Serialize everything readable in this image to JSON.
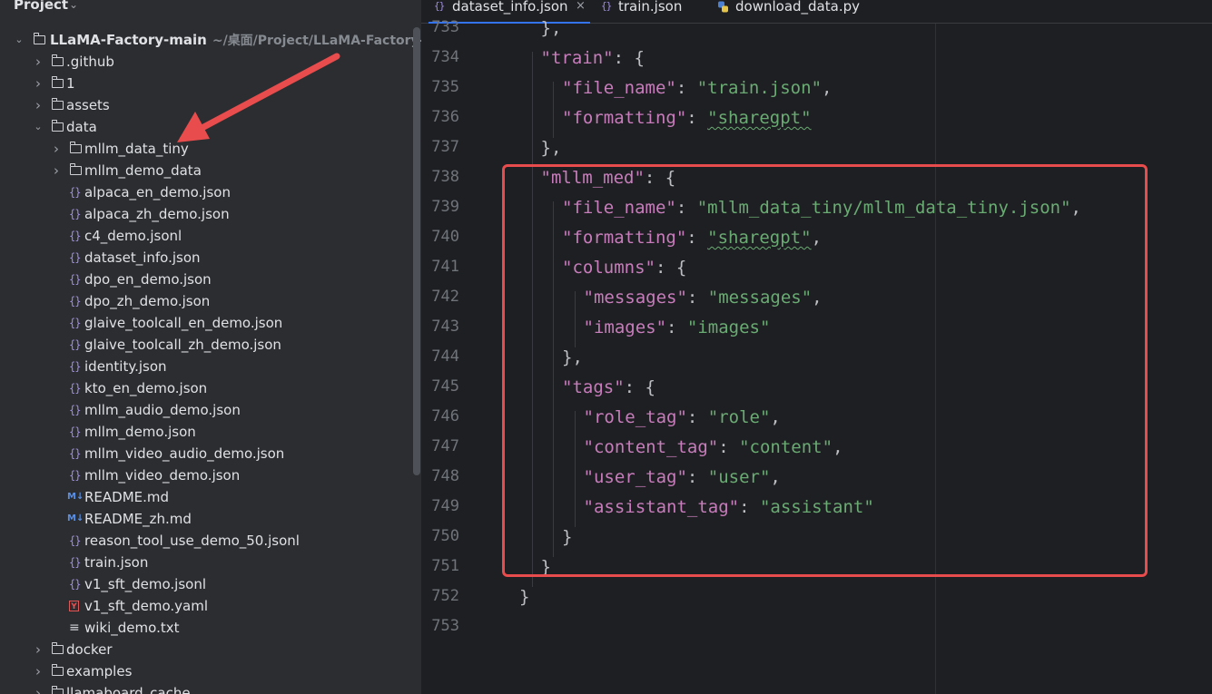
{
  "project": {
    "title": "Project",
    "root": {
      "name": "LLaMA-Factory-main",
      "path_hint": "~/桌面/Project/LLaMA-Factory-main"
    },
    "items": [
      {
        "label": ".github",
        "type": "folder",
        "expanded": false
      },
      {
        "label": "1",
        "type": "folder",
        "expanded": false
      },
      {
        "label": "assets",
        "type": "folder",
        "expanded": false
      },
      {
        "label": "data",
        "type": "folder",
        "expanded": true
      },
      {
        "label": "mllm_data_tiny",
        "type": "folder",
        "expanded": false
      },
      {
        "label": "mllm_demo_data",
        "type": "folder",
        "expanded": false
      },
      {
        "label": "alpaca_en_demo.json",
        "type": "json"
      },
      {
        "label": "alpaca_zh_demo.json",
        "type": "json"
      },
      {
        "label": "c4_demo.jsonl",
        "type": "json"
      },
      {
        "label": "dataset_info.json",
        "type": "json"
      },
      {
        "label": "dpo_en_demo.json",
        "type": "json"
      },
      {
        "label": "dpo_zh_demo.json",
        "type": "json"
      },
      {
        "label": "glaive_toolcall_en_demo.json",
        "type": "json"
      },
      {
        "label": "glaive_toolcall_zh_demo.json",
        "type": "json"
      },
      {
        "label": "identity.json",
        "type": "json"
      },
      {
        "label": "kto_en_demo.json",
        "type": "json"
      },
      {
        "label": "mllm_audio_demo.json",
        "type": "json"
      },
      {
        "label": "mllm_demo.json",
        "type": "json"
      },
      {
        "label": "mllm_video_audio_demo.json",
        "type": "json"
      },
      {
        "label": "mllm_video_demo.json",
        "type": "json"
      },
      {
        "label": "README.md",
        "type": "md"
      },
      {
        "label": "README_zh.md",
        "type": "md"
      },
      {
        "label": "reason_tool_use_demo_50.jsonl",
        "type": "json"
      },
      {
        "label": "train.json",
        "type": "json"
      },
      {
        "label": "v1_sft_demo.jsonl",
        "type": "json"
      },
      {
        "label": "v1_sft_demo.yaml",
        "type": "yaml"
      },
      {
        "label": "wiki_demo.txt",
        "type": "txt"
      },
      {
        "label": "docker",
        "type": "folder",
        "expanded": false
      },
      {
        "label": "examples",
        "type": "folder",
        "expanded": false
      },
      {
        "label": "llamaboard_cache",
        "type": "folder",
        "expanded": false
      }
    ]
  },
  "tabs": [
    {
      "label": "dataset_info.json",
      "icon": "json-file-icon",
      "active": true,
      "closable": true
    },
    {
      "label": "train.json",
      "icon": "json-file-icon",
      "active": false
    },
    {
      "label": "download_data.py",
      "icon": "python-file-icon",
      "active": false
    }
  ],
  "editor": {
    "line_numbers": [
      "733",
      "734",
      "735",
      "736",
      "737",
      "738",
      "739",
      "740",
      "741",
      "742",
      "743",
      "744",
      "745",
      "746",
      "747",
      "748",
      "749",
      "750",
      "751",
      "752",
      "753"
    ],
    "lines": [
      {
        "indent": 1,
        "tokens": [
          {
            "t": "p",
            "v": "},"
          }
        ]
      },
      {
        "indent": 1,
        "tokens": [
          {
            "t": "k",
            "v": "\"train\""
          },
          {
            "t": "p",
            "v": ": {"
          }
        ]
      },
      {
        "indent": 2,
        "tokens": [
          {
            "t": "k",
            "v": "\"file_name\""
          },
          {
            "t": "p",
            "v": ": "
          },
          {
            "t": "s",
            "v": "\"train.json\""
          },
          {
            "t": "p",
            "v": ","
          }
        ]
      },
      {
        "indent": 2,
        "tokens": [
          {
            "t": "k",
            "v": "\"formatting\""
          },
          {
            "t": "p",
            "v": ": "
          },
          {
            "t": "s",
            "v": "\"sharegpt\"",
            "sq": true
          }
        ]
      },
      {
        "indent": 1,
        "tokens": [
          {
            "t": "p",
            "v": "},"
          }
        ]
      },
      {
        "indent": 1,
        "tokens": [
          {
            "t": "k",
            "v": "\"mllm_med\""
          },
          {
            "t": "p",
            "v": ": {"
          }
        ]
      },
      {
        "indent": 2,
        "tokens": [
          {
            "t": "k",
            "v": "\"file_name\""
          },
          {
            "t": "p",
            "v": ": "
          },
          {
            "t": "s",
            "v": "\"mllm_data_tiny/mllm_data_tiny.json\""
          },
          {
            "t": "p",
            "v": ","
          }
        ]
      },
      {
        "indent": 2,
        "tokens": [
          {
            "t": "k",
            "v": "\"formatting\""
          },
          {
            "t": "p",
            "v": ": "
          },
          {
            "t": "s",
            "v": "\"sharegpt\"",
            "sq": true
          },
          {
            "t": "p",
            "v": ","
          }
        ]
      },
      {
        "indent": 2,
        "tokens": [
          {
            "t": "k",
            "v": "\"columns\""
          },
          {
            "t": "p",
            "v": ": {"
          }
        ]
      },
      {
        "indent": 3,
        "tokens": [
          {
            "t": "k",
            "v": "\"messages\""
          },
          {
            "t": "p",
            "v": ": "
          },
          {
            "t": "s",
            "v": "\"messages\""
          },
          {
            "t": "p",
            "v": ","
          }
        ]
      },
      {
        "indent": 3,
        "tokens": [
          {
            "t": "k",
            "v": "\"images\""
          },
          {
            "t": "p",
            "v": ": "
          },
          {
            "t": "s",
            "v": "\"images\""
          }
        ]
      },
      {
        "indent": 2,
        "tokens": [
          {
            "t": "p",
            "v": "},"
          }
        ]
      },
      {
        "indent": 2,
        "tokens": [
          {
            "t": "k",
            "v": "\"tags\""
          },
          {
            "t": "p",
            "v": ": {"
          }
        ]
      },
      {
        "indent": 3,
        "tokens": [
          {
            "t": "k",
            "v": "\"role_tag\""
          },
          {
            "t": "p",
            "v": ": "
          },
          {
            "t": "s",
            "v": "\"role\""
          },
          {
            "t": "p",
            "v": ","
          }
        ]
      },
      {
        "indent": 3,
        "tokens": [
          {
            "t": "k",
            "v": "\"content_tag\""
          },
          {
            "t": "p",
            "v": ": "
          },
          {
            "t": "s",
            "v": "\"content\""
          },
          {
            "t": "p",
            "v": ","
          }
        ]
      },
      {
        "indent": 3,
        "tokens": [
          {
            "t": "k",
            "v": "\"user_tag\""
          },
          {
            "t": "p",
            "v": ": "
          },
          {
            "t": "s",
            "v": "\"user\""
          },
          {
            "t": "p",
            "v": ","
          }
        ]
      },
      {
        "indent": 3,
        "tokens": [
          {
            "t": "k",
            "v": "\"assistant_tag\""
          },
          {
            "t": "p",
            "v": ": "
          },
          {
            "t": "s",
            "v": "\"assistant\""
          }
        ]
      },
      {
        "indent": 2,
        "tokens": [
          {
            "t": "p",
            "v": "}"
          }
        ]
      },
      {
        "indent": 1,
        "tokens": [
          {
            "t": "p",
            "v": "}"
          }
        ]
      },
      {
        "indent": 0,
        "tokens": [
          {
            "t": "p",
            "v": "}"
          }
        ]
      },
      {
        "indent": 0,
        "tokens": []
      }
    ]
  },
  "colors": {
    "highlight_box": "#e94c4c",
    "annotation_arrow": "#e94c4c",
    "json_key": "#c77dbb",
    "json_string": "#6aab73"
  }
}
